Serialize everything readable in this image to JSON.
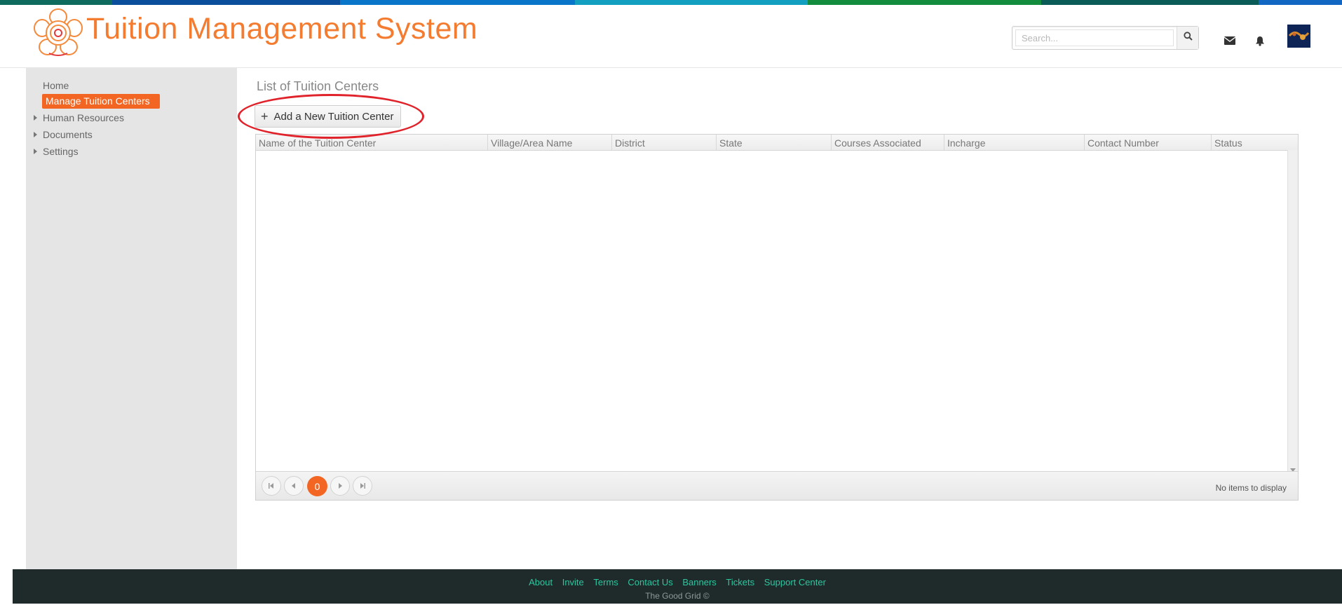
{
  "header": {
    "app_title": "Tuition Management System",
    "search_placeholder": "Search...",
    "icons": [
      "search-icon",
      "envelope-icon",
      "bell-icon",
      "avatar"
    ]
  },
  "colors": {
    "accent": "#f26522",
    "title": "#f47c30",
    "footer_bg": "#1f2b2b",
    "footer_link": "#2cc6a0",
    "highlight": "#e0232b",
    "topbar": [
      "#0f6b5e",
      "#0b4f9c",
      "#0a76c9",
      "#139fbf",
      "#138d3d",
      "#0b5b57",
      "#1267c2"
    ]
  },
  "sidebar": {
    "home": "Home",
    "active_item": "Manage Tuition  Centers",
    "items": [
      {
        "label": "Human Resources"
      },
      {
        "label": "Documents"
      },
      {
        "label": "Settings"
      }
    ]
  },
  "main": {
    "page_title": "List of Tuition Centers",
    "add_button": "Add a New Tuition Center",
    "add_button_icon": "+",
    "columns": [
      "Name of the Tuition Center",
      "Village/Area Name",
      "District",
      "State",
      "Courses Associated",
      "Incharge",
      "Contact Number",
      "Status"
    ],
    "pager": {
      "current_page": "0",
      "info": "No items to display"
    }
  },
  "footer": {
    "links": [
      "About",
      "Invite",
      "Terms",
      "Contact Us",
      "Banners",
      "Tickets",
      "Support Center"
    ],
    "copyright": "The Good Grid ©"
  }
}
